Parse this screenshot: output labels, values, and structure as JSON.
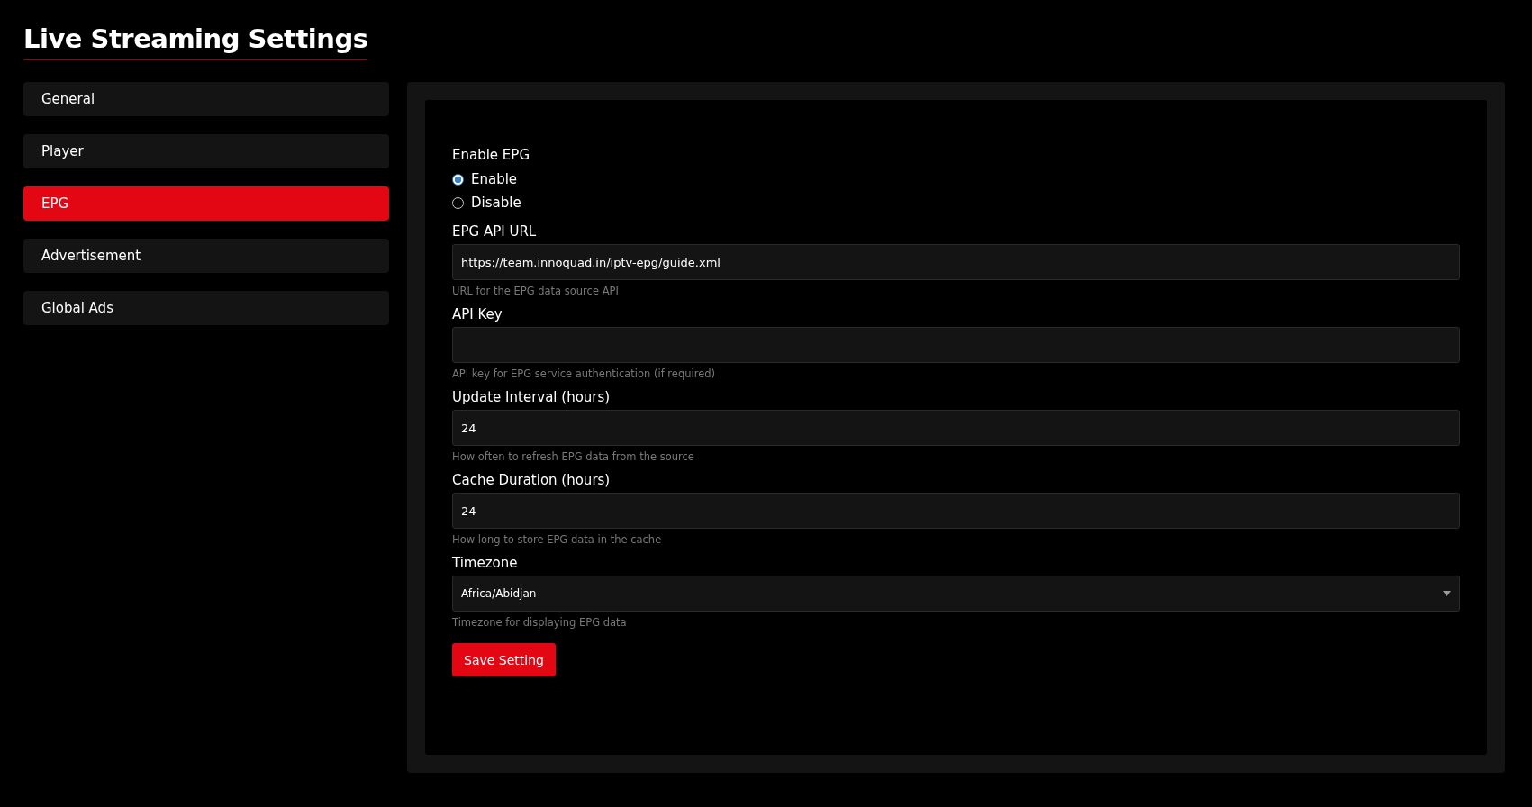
{
  "page": {
    "title": "Live Streaming Settings"
  },
  "sidebar": {
    "items": [
      {
        "label": "General",
        "selected": false
      },
      {
        "label": "Player",
        "selected": false
      },
      {
        "label": "EPG",
        "selected": true
      },
      {
        "label": "Advertisement",
        "selected": false
      },
      {
        "label": "Global Ads",
        "selected": false
      }
    ]
  },
  "form": {
    "enable_epg": {
      "label": "Enable EPG",
      "options": [
        {
          "label": "Enable",
          "selected": true
        },
        {
          "label": "Disable",
          "selected": false
        }
      ]
    },
    "fields": [
      {
        "kind": "text",
        "label": "EPG API URL",
        "value": "https://team.innoquad.in/iptv-epg/guide.xml",
        "help": "URL for the EPG data source API"
      },
      {
        "kind": "text",
        "label": "API Key",
        "help": "API key for EPG service authentication (if required)"
      },
      {
        "kind": "text",
        "label": "Update Interval (hours)",
        "value": "24",
        "help": "How often to refresh EPG data from the source"
      },
      {
        "kind": "text",
        "label": "Cache Duration (hours)",
        "value": "24",
        "help": "How long to store EPG data in the cache"
      },
      {
        "kind": "select",
        "label": "Timezone",
        "value": "Africa/Abidjan",
        "help": "Timezone for displaying EPG data"
      }
    ],
    "save_button": "Save Setting"
  }
}
